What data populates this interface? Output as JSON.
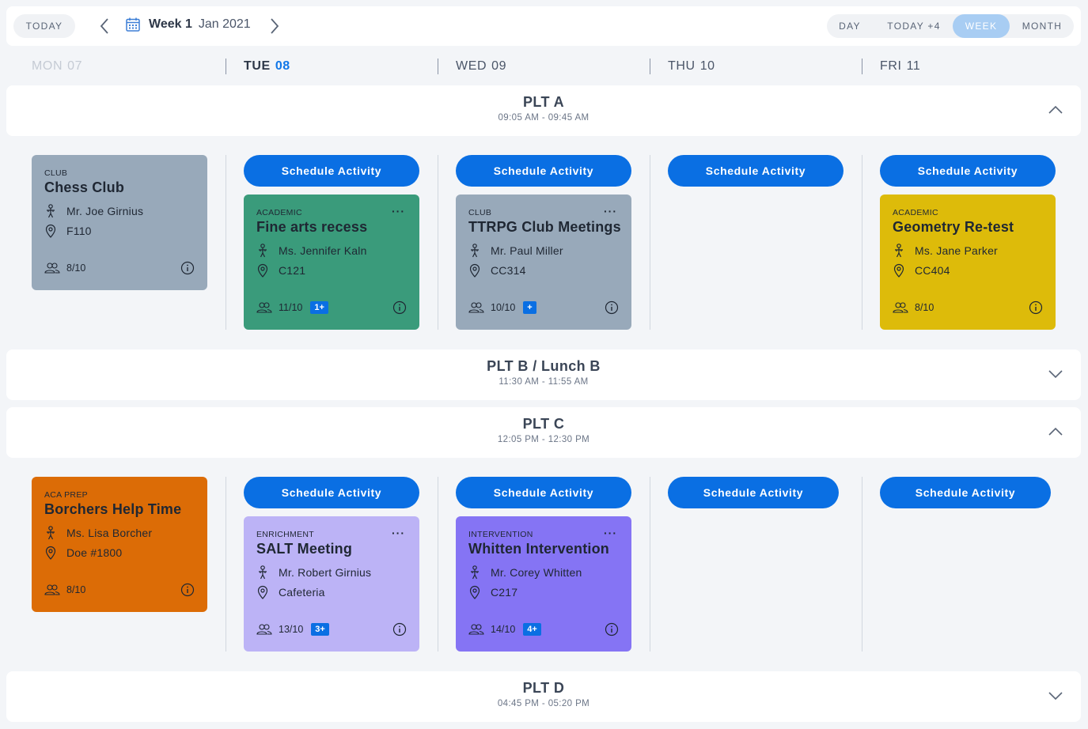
{
  "toolbar": {
    "today_label": "TODAY",
    "week_label": "Week 1",
    "month_label": "Jan 2021",
    "views": [
      "DAY",
      "TODAY +4",
      "WEEK",
      "MONTH"
    ],
    "active_view": "WEEK"
  },
  "days": [
    {
      "dow": "MON",
      "num": "07",
      "state": "past"
    },
    {
      "dow": "TUE",
      "num": "08",
      "state": "current"
    },
    {
      "dow": "WED",
      "num": "09",
      "state": "normal"
    },
    {
      "dow": "THU",
      "num": "10",
      "state": "normal"
    },
    {
      "dow": "FRI",
      "num": "11",
      "state": "normal"
    }
  ],
  "schedule_label": "Schedule Activity",
  "periods": [
    {
      "title": "PLT A",
      "time": "09:05 AM - 09:45 AM",
      "expanded": true,
      "cards": {
        "mon": {
          "category": "CLUB",
          "title": "Chess Club",
          "teacher": "Mr. Joe Girnius",
          "room": "F110",
          "count": "8/10",
          "badge": ""
        },
        "tue": {
          "category": "ACADEMIC",
          "title": "Fine arts recess",
          "teacher": "Ms. Jennifer Kaln",
          "room": "C121",
          "count": "11/10",
          "badge": "1+"
        },
        "wed": {
          "category": "CLUB",
          "title": "TTRPG Club Meetings",
          "teacher": "Mr. Paul Miller",
          "room": "CC314",
          "count": "10/10",
          "badge": "+"
        },
        "fri": {
          "category": "ACADEMIC",
          "title": "Geometry Re-test",
          "teacher": "Ms. Jane Parker",
          "room": "CC404",
          "count": "8/10",
          "badge": ""
        }
      }
    },
    {
      "title": "PLT B / Lunch B",
      "time": "11:30 AM - 11:55 AM",
      "expanded": false
    },
    {
      "title": "PLT C",
      "time": "12:05 PM - 12:30 PM",
      "expanded": true,
      "cards": {
        "mon": {
          "category": "ACA PREP",
          "title": "Borchers Help Time",
          "teacher": "Ms. Lisa Borcher",
          "room": "Doe #1800",
          "count": "8/10",
          "badge": ""
        },
        "tue": {
          "category": "ENRICHMENT",
          "title": "SALT Meeting",
          "teacher": "Mr. Robert Girnius",
          "room": "Cafeteria",
          "count": "13/10",
          "badge": "3+"
        },
        "wed": {
          "category": "INTERVENTION",
          "title": "Whitten Intervention",
          "teacher": "Mr. Corey Whitten",
          "room": "C217",
          "count": "14/10",
          "badge": "4+"
        }
      }
    },
    {
      "title": "PLT D",
      "time": "04:45 PM - 05:20 PM",
      "expanded": false
    }
  ],
  "colors": {
    "primary": "#0a6fe3",
    "club": "#98a9ba",
    "academic_green": "#3a9b7b",
    "academic_yellow": "#ddbb0a",
    "aca_prep": "#dc6c06",
    "enrichment": "#bcb3f6",
    "intervention": "#8574f4"
  }
}
